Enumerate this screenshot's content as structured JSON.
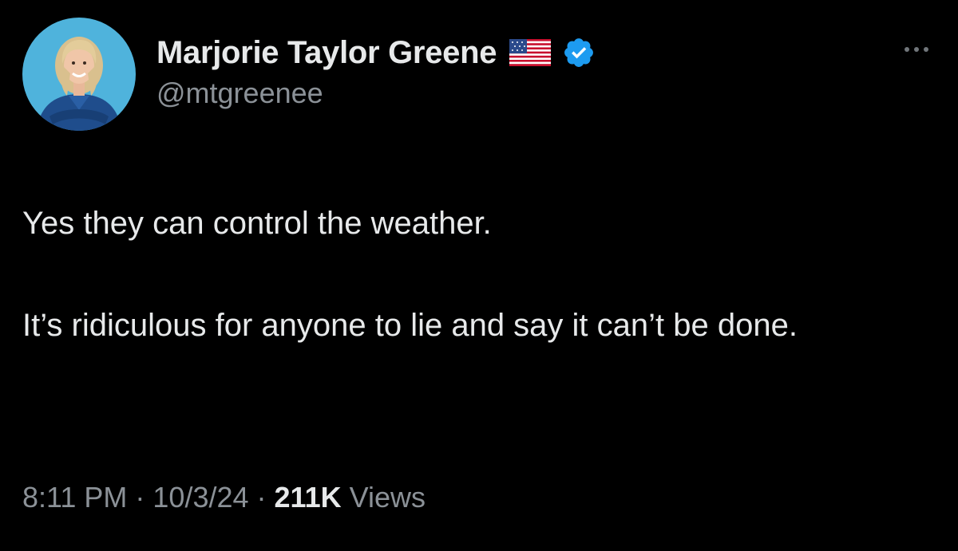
{
  "tweet": {
    "author": {
      "display_name": "Marjorie Taylor Greene",
      "handle": "@mtgreenee",
      "badges": [
        "us-flag-icon",
        "verified-icon"
      ],
      "verified_color": "#1d9bf0"
    },
    "text_paragraphs": [
      "Yes they can control the weather.",
      "It’s ridiculous for anyone to lie and say it can’t be done."
    ],
    "meta": {
      "time": "8:11 PM",
      "date": "10/3/24",
      "views_count": "211K",
      "views_label": "Views",
      "separator": "·"
    },
    "menu_icon": "more-dots-icon"
  },
  "colors": {
    "background": "#000000",
    "primary_text": "#e7e9ea",
    "secondary_text": "#8b9197",
    "avatar_background": "#4fb3dc"
  }
}
